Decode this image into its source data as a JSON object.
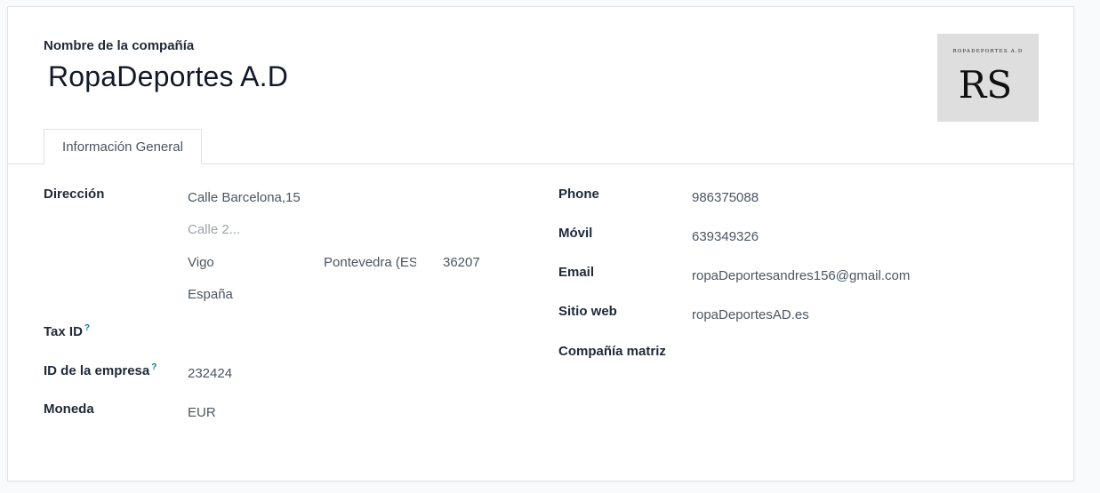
{
  "header": {
    "company_label": "Nombre de la compañía",
    "company_name": "RopaDeportes A.D",
    "logo": {
      "top_text": "ROPADEPORTES A.D",
      "monogram": "RS"
    }
  },
  "tabs": [
    {
      "label": "Información General",
      "active": true
    }
  ],
  "left": {
    "address_label": "Dirección",
    "street": "Calle Barcelona,15",
    "street2_placeholder": "Calle 2...",
    "city": "Vigo",
    "state": "Pontevedra (ES)",
    "zip": "36207",
    "country": "España",
    "tax_id_label": "Tax ID",
    "tax_id_help": "?",
    "company_id_label": "ID de la empresa",
    "company_id_help": "?",
    "company_id_value": "232424",
    "currency_label": "Moneda",
    "currency_value": "EUR"
  },
  "right": {
    "phone_label": "Phone",
    "phone_value": "986375088",
    "mobile_label": "Móvil",
    "mobile_value": "639349326",
    "email_label": "Email",
    "email_value": "ropaDeportesandres156@gmail.com",
    "website_label": "Sitio web",
    "website_value": "ropaDeportesAD.es",
    "parent_label": "Compañía matriz"
  }
}
